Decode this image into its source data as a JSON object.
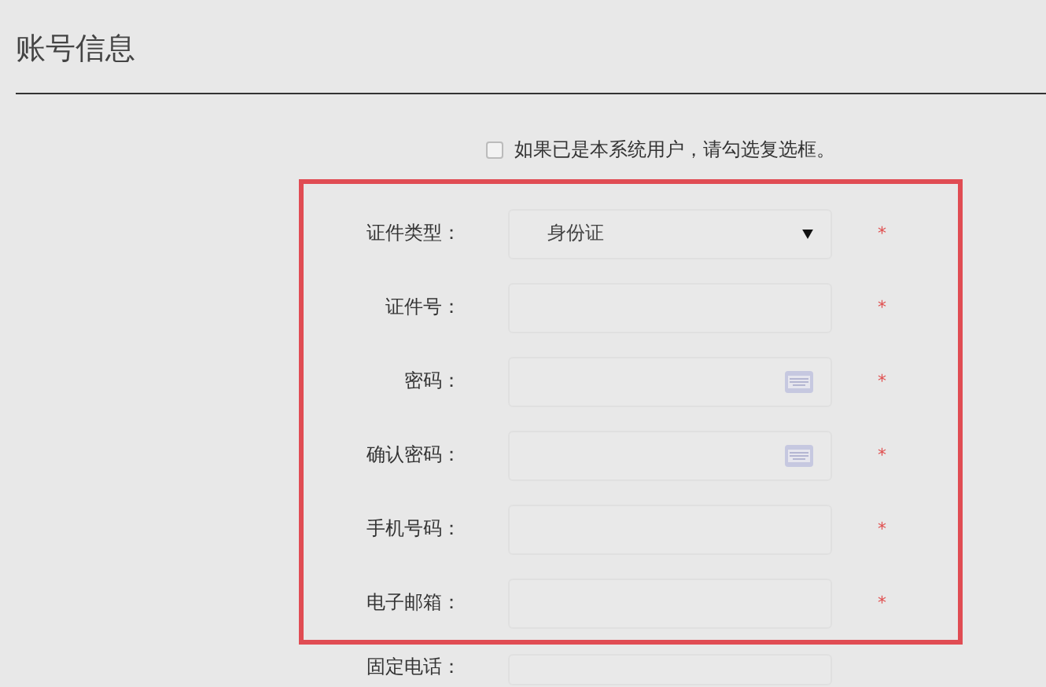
{
  "title": "账号信息",
  "existing_user": {
    "label": "如果已是本系统用户，请勾选复选框。",
    "checked": false
  },
  "highlighted_fields": [
    {
      "label": "证件类型：",
      "kind": "select",
      "value": "身份证",
      "required": true
    },
    {
      "label": "证件号：",
      "kind": "text",
      "required": true
    },
    {
      "label": "密码：",
      "kind": "password",
      "required": true
    },
    {
      "label": "确认密码：",
      "kind": "password",
      "required": true
    },
    {
      "label": "手机号码：",
      "kind": "text",
      "required": true
    },
    {
      "label": "电子邮箱：",
      "kind": "text",
      "required": true
    }
  ],
  "other_fields": [
    {
      "label": "固定电话：",
      "required": false
    }
  ],
  "required_mark": "*"
}
